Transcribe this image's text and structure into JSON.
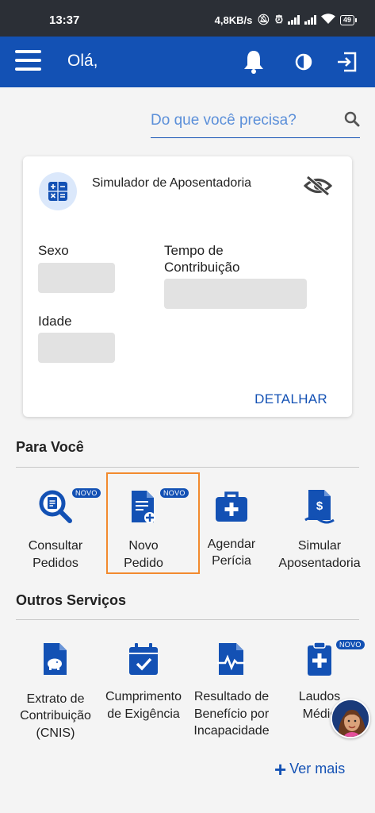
{
  "status_bar": {
    "time": "13:37",
    "speed": "4,8KB/s",
    "battery": "49"
  },
  "app_bar": {
    "greeting": "Olá,"
  },
  "search": {
    "placeholder": "Do que você precisa?"
  },
  "simulator_card": {
    "title": "Simulador de Aposentadoria",
    "sexo_label": "Sexo",
    "tempo_label_line1": "Tempo de",
    "tempo_label_line2": "Contribuição",
    "idade_label": "Idade",
    "detail_button": "DETALHAR"
  },
  "para_voce": {
    "title": "Para Você",
    "items": [
      {
        "line1": "Consultar",
        "line2": "Pedidos",
        "badge": "NOVO"
      },
      {
        "line1": "Novo",
        "line2": "Pedido",
        "badge": "NOVO"
      },
      {
        "line1": "Agendar",
        "line2": "Perícia"
      },
      {
        "line1": "Simular",
        "line2": "Aposentadoria"
      }
    ]
  },
  "outros_servicos": {
    "title": "Outros Serviços",
    "items": [
      {
        "line1": "Extrato de",
        "line2": "Contribuição",
        "line3": "(CNIS)"
      },
      {
        "line1": "Cumprimento",
        "line2": "de Exigência"
      },
      {
        "line1": "Resultado de",
        "line2": "Benefício por",
        "line3": "Incapacidade"
      },
      {
        "line1": "Laudos",
        "line2": "Médic",
        "badge": "NOVO"
      }
    ]
  },
  "ver_mais": "Ver mais",
  "colors": {
    "primary": "#1351b4",
    "highlight": "#f28a2e"
  }
}
